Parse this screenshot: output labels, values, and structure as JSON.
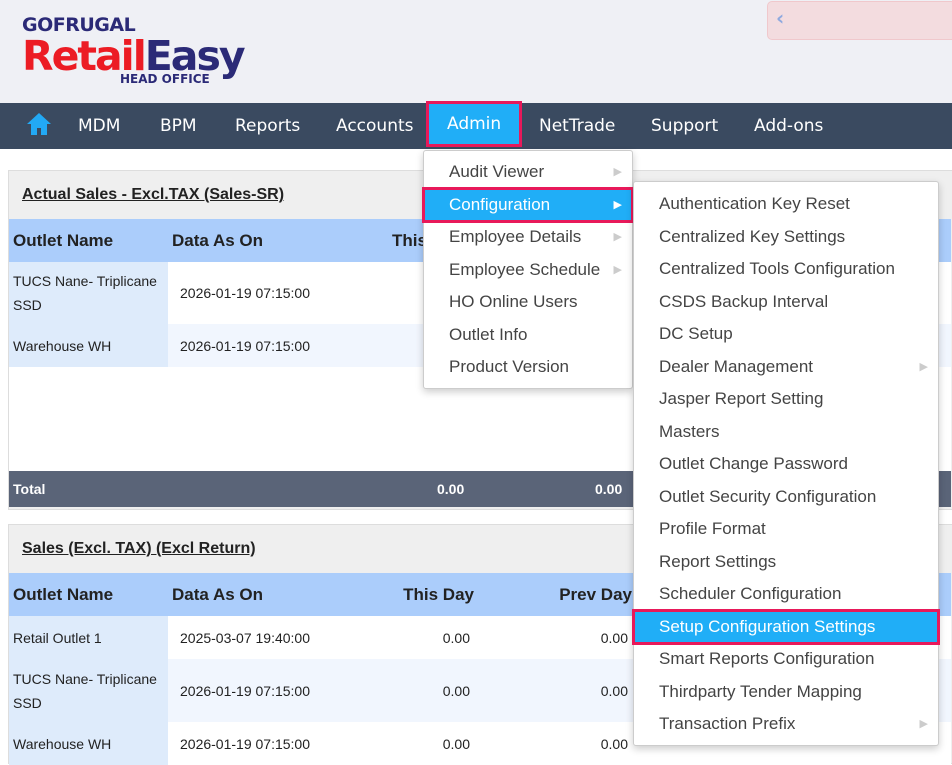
{
  "brand": {
    "company": "GOFRUGAL",
    "product_a": "Retail",
    "product_b": "Easy",
    "edition": "HEAD OFFICE"
  },
  "nav": {
    "items": [
      "MDM",
      "BPM",
      "Reports",
      "Accounts",
      "Admin",
      "NetTrade",
      "Support",
      "Add-ons"
    ],
    "active": "Admin"
  },
  "admin_menu": {
    "items": [
      "Audit Viewer",
      "Configuration",
      "Employee Details",
      "Employee Schedule",
      "HO Online Users",
      "Outlet Info",
      "Product Version"
    ],
    "highlighted": "Configuration"
  },
  "config_menu": {
    "items": [
      "Authentication Key Reset",
      "Centralized Key Settings",
      "Centralized Tools Configuration",
      "CSDS Backup Interval",
      "DC Setup",
      "Dealer Management",
      "Jasper Report Setting",
      "Masters",
      "Outlet Change Password",
      "Outlet Security Configuration",
      "Profile Format",
      "Report Settings",
      "Scheduler Configuration",
      "Setup Configuration Settings",
      "Smart Reports Configuration",
      "Thirdparty Tender Mapping",
      "Transaction Prefix"
    ],
    "highlighted": "Setup Configuration Settings"
  },
  "panel1": {
    "title": "Actual Sales - Excl.TAX (Sales-SR)",
    "headers": [
      "Outlet Name",
      "Data As On",
      "This"
    ],
    "rows": [
      [
        "TUCS Nane- Triplicane SSD",
        "2026-01-19 07:15:00"
      ],
      [
        "Warehouse WH",
        "2026-01-19 07:15:00"
      ]
    ],
    "total": {
      "label": "Total",
      "this_day": "0.00",
      "prev_day": "0.00"
    }
  },
  "panel2": {
    "title": "Sales (Excl. TAX) (Excl Return)",
    "headers": [
      "Outlet Name",
      "Data As On",
      "This Day",
      "Prev Day"
    ],
    "rows": [
      [
        "Retail Outlet 1",
        "2025-03-07 19:40:00",
        "0.00",
        "0.00"
      ],
      [
        "TUCS Nane- Triplicane SSD",
        "2026-01-19 07:15:00",
        "0.00",
        "0.00"
      ],
      [
        "Warehouse WH",
        "2026-01-19 07:15:00",
        "0.00",
        "0.00"
      ]
    ]
  }
}
